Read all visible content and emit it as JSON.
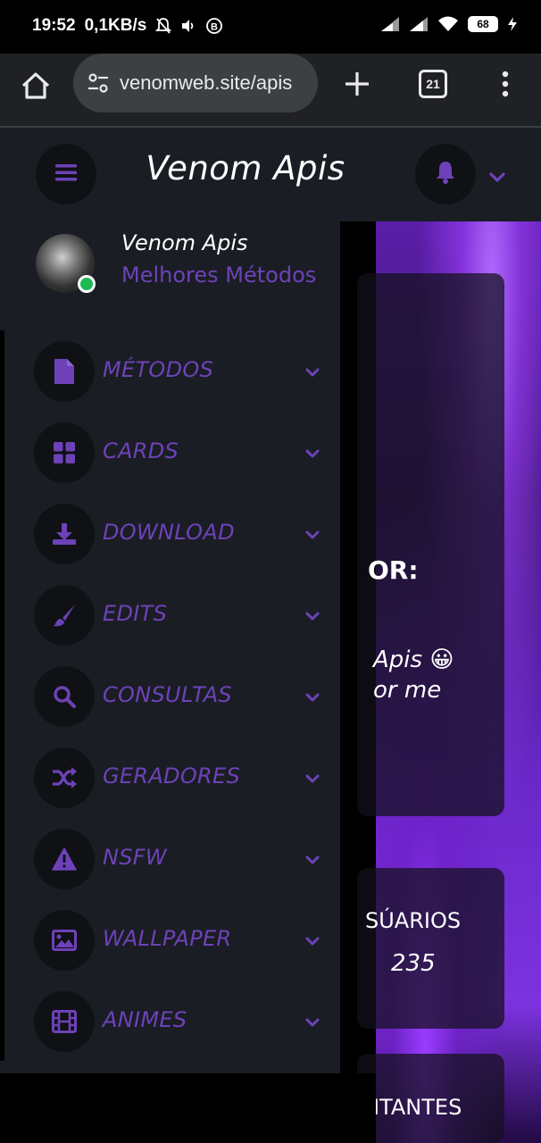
{
  "status_bar": {
    "time": "19:52",
    "net_speed": "0,1KB/s",
    "battery": "68",
    "icons": [
      "bell-off-icon",
      "volume-icon",
      "b-icon",
      "signal-icon",
      "signal-icon",
      "wifi-icon",
      "battery-icon",
      "charging-icon"
    ]
  },
  "browser": {
    "url": "venomweb.site/apis",
    "tab_count": "21",
    "icons": [
      "home-icon",
      "tune-icon",
      "plus-icon",
      "tabs-icon",
      "more-vert-icon"
    ]
  },
  "app_header": {
    "title": "Venom Apis",
    "icons": [
      "hamburger-icon",
      "bell-icon",
      "chevron-down-icon"
    ]
  },
  "drawer": {
    "profile": {
      "name": "Venom Apis",
      "subtitle": "Melhores Métodos"
    },
    "items": [
      {
        "label": "MÉTODOS",
        "icon": "file-icon"
      },
      {
        "label": "CARDS",
        "icon": "grid-icon"
      },
      {
        "label": "DOWNLOAD",
        "icon": "download-icon"
      },
      {
        "label": "EDITS",
        "icon": "brush-icon"
      },
      {
        "label": "CONSULTAS",
        "icon": "search-icon"
      },
      {
        "label": "GERADORES",
        "icon": "shuffle-icon"
      },
      {
        "label": "NSFW",
        "icon": "warning-icon"
      },
      {
        "label": "WALLPAPER",
        "icon": "image-icon"
      },
      {
        "label": "ANIMES",
        "icon": "film-icon"
      }
    ]
  },
  "background": {
    "heading": "OR:",
    "line1": "Apis 😀",
    "line2": "or me",
    "users_label": "SÚARIOS",
    "users_value": "235",
    "visitors_label": "ITANTES"
  },
  "colors": {
    "accent": "#6d42b8",
    "panel": "#1a1d24",
    "icon_circle": "#0f1115",
    "online": "#1db954"
  }
}
